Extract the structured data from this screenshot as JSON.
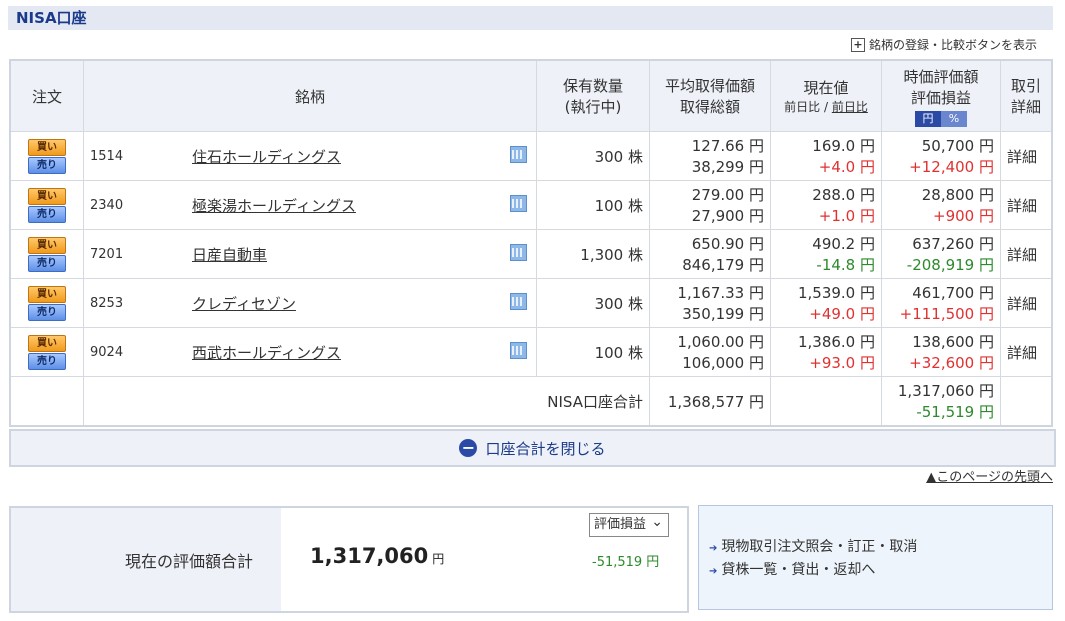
{
  "section": {
    "title": "NISA口座"
  },
  "compare_toggle": {
    "label": "銘柄の登録・比較ボタンを表示"
  },
  "table": {
    "headers": {
      "order": "注文",
      "stock": "銘柄",
      "qty_line1": "保有数量",
      "qty_line2": "(執行中)",
      "avg_line1": "平均取得価額",
      "avg_line2": "取得総額",
      "price_line1": "現在値",
      "price_sub_a": "前日比",
      "price_sub_sep": " / ",
      "price_sub_b": "前日比",
      "eval_line1": "時価評価額",
      "eval_line2": "評価損益",
      "toggle_yen": "円",
      "toggle_pct": "%",
      "detail_line1": "取引",
      "detail_line2": "詳細"
    },
    "buy_label": "買い",
    "sell_label": "売り",
    "detail_label": "詳細",
    "rows": [
      {
        "code": "1514",
        "name": "住石ホールディングス",
        "qty": "300 株",
        "avg_price": "127.66 円",
        "total_cost": "38,299 円",
        "price": "169.0 円",
        "change": "+4.0 円",
        "market_value": "50,700 円",
        "pl": "+12,400 円"
      },
      {
        "code": "2340",
        "name": "極楽湯ホールディングス",
        "qty": "100 株",
        "avg_price": "279.00 円",
        "total_cost": "27,900 円",
        "price": "288.0 円",
        "change": "+1.0 円",
        "market_value": "28,800 円",
        "pl": "+900 円"
      },
      {
        "code": "7201",
        "name": "日産自動車",
        "qty": "1,300 株",
        "avg_price": "650.90 円",
        "total_cost": "846,179 円",
        "price": "490.2 円",
        "change": "-14.8 円",
        "market_value": "637,260 円",
        "pl": "-208,919 円"
      },
      {
        "code": "8253",
        "name": "クレディセゾン",
        "qty": "300 株",
        "avg_price": "1,167.33 円",
        "total_cost": "350,199 円",
        "price": "1,539.0 円",
        "change": "+49.0 円",
        "market_value": "461,700 円",
        "pl": "+111,500 円"
      },
      {
        "code": "9024",
        "name": "西武ホールディングス",
        "qty": "100 株",
        "avg_price": "1,060.00 円",
        "total_cost": "106,000 円",
        "price": "1,386.0 円",
        "change": "+93.0 円",
        "market_value": "138,600 円",
        "pl": "+32,600 円"
      }
    ],
    "total": {
      "label": "NISA口座合計",
      "total_cost": "1,368,577 円",
      "market_value": "1,317,060 円",
      "pl": "-51,519 円"
    }
  },
  "close_total": {
    "label": "口座合計を閉じる"
  },
  "page_top": {
    "label": "▲このページの先頭へ"
  },
  "summary": {
    "label": "現在の評価額合計",
    "value": "1,317,060",
    "unit": "円",
    "select_value": "評価損益",
    "pl": "-51,519 円"
  },
  "links": [
    {
      "label": "現物取引注文照会・訂正・取消"
    },
    {
      "label": "貸株一覧・貸出・返却へ"
    }
  ],
  "colors": {
    "positive": "#e03131",
    "negative": "#2c8a2c",
    "accent": "#2a4aa6"
  }
}
